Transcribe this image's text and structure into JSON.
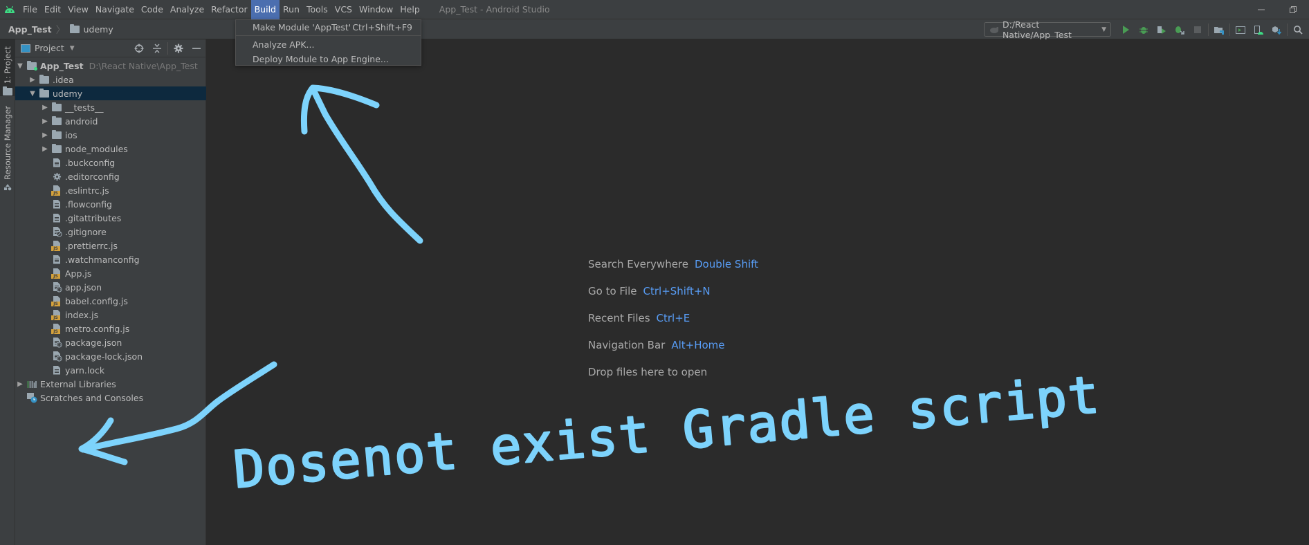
{
  "app": {
    "window_title": "App_Test - Android Studio",
    "logo_icon": "android-icon"
  },
  "menubar": {
    "items": [
      {
        "label": "File"
      },
      {
        "label": "Edit"
      },
      {
        "label": "View"
      },
      {
        "label": "Navigate"
      },
      {
        "label": "Code"
      },
      {
        "label": "Analyze"
      },
      {
        "label": "Refactor"
      },
      {
        "label": "Build",
        "active": true
      },
      {
        "label": "Run"
      },
      {
        "label": "Tools"
      },
      {
        "label": "VCS"
      },
      {
        "label": "Window"
      },
      {
        "label": "Help"
      }
    ]
  },
  "window_controls": {
    "minimize_icon": "minimize-icon",
    "restore_icon": "restore-icon"
  },
  "build_menu": {
    "items": [
      {
        "label": "Make Module 'AppTest'",
        "shortcut": "Ctrl+Shift+F9"
      },
      {
        "label": "Analyze APK..."
      },
      {
        "label": "Deploy Module to App Engine..."
      }
    ]
  },
  "breadcrumb": {
    "root": "App_Test",
    "folder": "udemy"
  },
  "toolbar": {
    "run_config": "D:/React Native/App_Test",
    "icons": [
      "run-icon",
      "debug-icon",
      "coverage-icon",
      "attach-debugger-icon",
      "stop-icon",
      "project-structure-icon",
      "terminal-icon",
      "avd-manager-icon",
      "sdk-manager-icon",
      "search-icon"
    ]
  },
  "left_stripe": {
    "tabs": [
      {
        "label": "1: Project",
        "active": true
      },
      {
        "label": "Resource Manager"
      }
    ]
  },
  "project_panel": {
    "title": "Project",
    "tools": [
      "locate-icon",
      "collapse-all-icon",
      "gear-icon",
      "hide-icon"
    ],
    "root": {
      "name": "App_Test",
      "path": "D:\\React Native\\App_Test"
    },
    "tree": [
      {
        "name": ".idea",
        "type": "folder",
        "depth": 1,
        "expanded": false
      },
      {
        "name": "udemy",
        "type": "folder",
        "depth": 1,
        "expanded": true,
        "selected": true
      },
      {
        "name": "__tests__",
        "type": "folder",
        "depth": 2,
        "expanded": false
      },
      {
        "name": "android",
        "type": "folder",
        "depth": 2,
        "expanded": false
      },
      {
        "name": "ios",
        "type": "folder",
        "depth": 2,
        "expanded": false
      },
      {
        "name": "node_modules",
        "type": "folder",
        "depth": 2,
        "expanded": false
      },
      {
        "name": ".buckconfig",
        "type": "text",
        "depth": 2
      },
      {
        "name": ".editorconfig",
        "type": "config",
        "depth": 2
      },
      {
        "name": ".eslintrc.js",
        "type": "js",
        "depth": 2
      },
      {
        "name": ".flowconfig",
        "type": "text",
        "depth": 2
      },
      {
        "name": ".gitattributes",
        "type": "text",
        "depth": 2
      },
      {
        "name": ".gitignore",
        "type": "ignore",
        "depth": 2
      },
      {
        "name": ".prettierrc.js",
        "type": "js",
        "depth": 2
      },
      {
        "name": ".watchmanconfig",
        "type": "text",
        "depth": 2
      },
      {
        "name": "App.js",
        "type": "js",
        "depth": 2
      },
      {
        "name": "app.json",
        "type": "json",
        "depth": 2
      },
      {
        "name": "babel.config.js",
        "type": "js",
        "depth": 2
      },
      {
        "name": "index.js",
        "type": "js",
        "depth": 2
      },
      {
        "name": "metro.config.js",
        "type": "js",
        "depth": 2
      },
      {
        "name": "package.json",
        "type": "json",
        "depth": 2
      },
      {
        "name": "package-lock.json",
        "type": "json",
        "depth": 2
      },
      {
        "name": "yarn.lock",
        "type": "text",
        "depth": 2
      }
    ],
    "external_libraries": "External Libraries",
    "scratches": "Scratches and Consoles"
  },
  "editor": {
    "hints": [
      {
        "label": "Search Everywhere",
        "key": "Double Shift"
      },
      {
        "label": "Go to File",
        "key": "Ctrl+Shift+N"
      },
      {
        "label": "Recent Files",
        "key": "Ctrl+E"
      },
      {
        "label": "Navigation Bar",
        "key": "Alt+Home"
      },
      {
        "label": "Drop files here to open",
        "key": ""
      }
    ]
  },
  "annotation": {
    "text": "Dosenot exist Gradle script",
    "color": "#7dd3fc"
  },
  "colors": {
    "accent": "#4b6eaf",
    "selection": "#0d293e",
    "shortcut_key": "#589df6",
    "android_green": "#3ddc84",
    "run_green": "#499c54"
  }
}
